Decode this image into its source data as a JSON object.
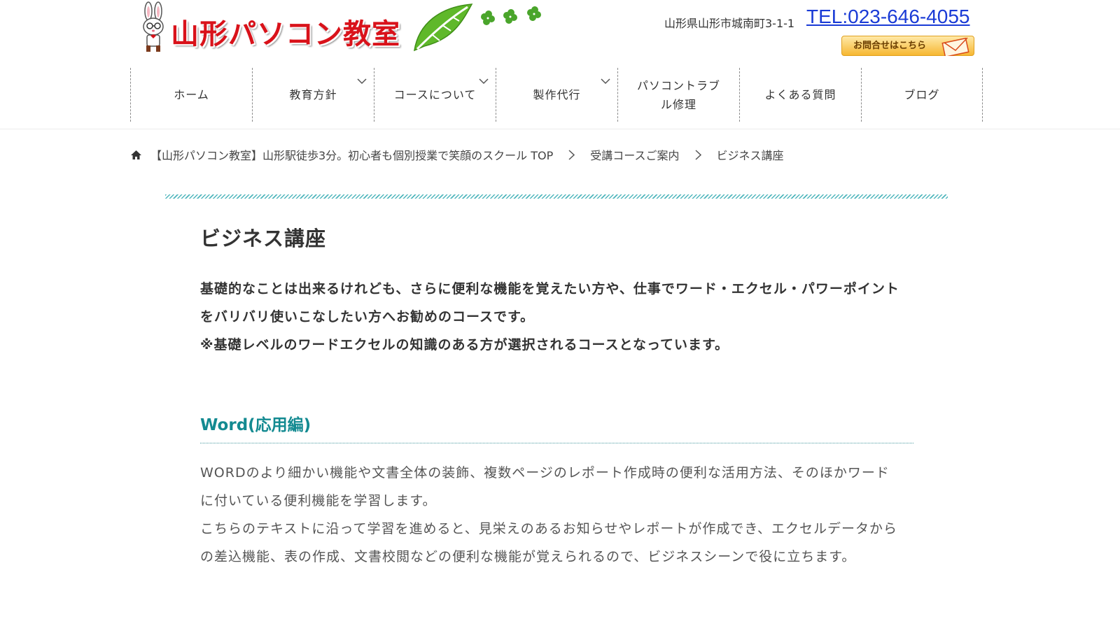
{
  "header": {
    "logo_text": "山形パソコン教室",
    "address": "山形県山形市城南町3-1-1",
    "tel": "TEL:023-646-4055",
    "contact_label": "お問合せはこちら"
  },
  "nav": {
    "items": [
      {
        "label": "ホーム"
      },
      {
        "label": "教育方針"
      },
      {
        "label": "コースについて"
      },
      {
        "label": "製作代行"
      },
      {
        "label_line1": "パソコントラブ",
        "label_line2": "ル修理"
      },
      {
        "label": "よくある質問"
      },
      {
        "label": "ブログ"
      }
    ]
  },
  "breadcrumb": {
    "items": [
      {
        "label": "【山形パソコン教室】山形駅徒歩3分。初心者も個別授業で笑顔のスクール TOP"
      },
      {
        "label": "受講コースご案内"
      },
      {
        "label": "ビジネス講座"
      }
    ]
  },
  "main": {
    "title": "ビジネス講座",
    "lead": [
      "基礎的なことは出来るけれども、さらに便利な機能を覚えたい方や、仕事でワード・エクセル・パワーポイント",
      "をバリバリ使いこなしたい方へお勧めのコースです。",
      "※基礎レベルのワードエクセルの知識のある方が選択されるコースとなっています。"
    ],
    "section": {
      "heading": "Word(応用編)",
      "body": [
        "WORDのより細かい機能や文書全体の装飾、複数ページのレポート作成時の便利な活用方法、そのほかワード",
        "に付いている便利機能を学習します。",
        "こちらのテキストに沿って学習を進めると、見栄えのあるお知らせやレポートが作成でき、エクセルデータから",
        "の差込機能、表の作成、文書校閲などの便利な機能が覚えられるので、ビジネスシーンで役に立ちます。"
      ]
    }
  },
  "colors": {
    "logo_red": "#d9121a",
    "tel_blue": "#1a3bd6",
    "accent_teal": "#138a91"
  },
  "icons": {
    "mascot": "rabbit-mascot-icon",
    "leaf": "leaf-icon",
    "clover": "clover-icon",
    "mail": "envelope-icon",
    "home": "home-icon",
    "chevron_down": "chevron-down-icon",
    "chevron_right": "chevron-right-icon"
  }
}
